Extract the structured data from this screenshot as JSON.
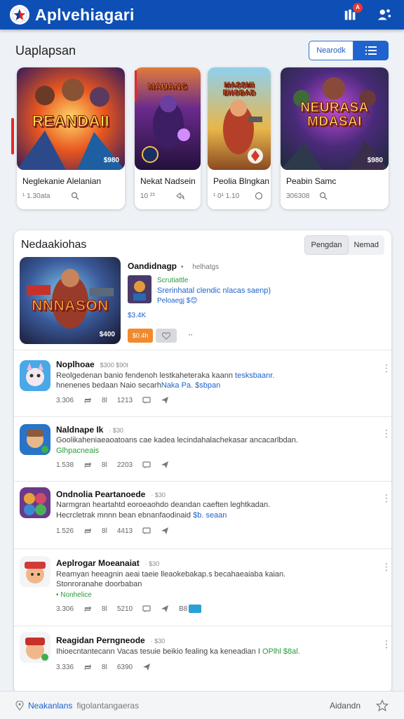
{
  "app": {
    "title": "Aplvehiagari",
    "notification_count": "A",
    "brand_color": "#0d4fb5"
  },
  "section": {
    "title": "Uaplapsan",
    "toggle_label": "Nearodk"
  },
  "cards": [
    {
      "thumb_text": "REANDAII",
      "price": "$980",
      "title": "Neglekanie Alelanian",
      "meta": "¹ 1.30ata"
    },
    {
      "thumb_text": "MAUANG",
      "title": "Nekat Nadsein",
      "meta": "10 ²³"
    },
    {
      "thumb_text": "MASSMI ENGBAD",
      "title": "Peolia Blngkan",
      "meta": "¹ 0¹ 1.10"
    },
    {
      "thumb_text": "NEURASA MDASAI",
      "price": "$980",
      "title": "Peabin Samc",
      "meta": "306308"
    }
  ],
  "panel": {
    "title": "Nedaakiohas",
    "tabs": [
      "Pengdan",
      "Nemad"
    ],
    "featured": {
      "image_text": "NNNASON",
      "image_price": "$400",
      "title": "Oandidnagp",
      "subtitle": "•  helhatgs",
      "line1": "Scrutiattle",
      "line2": "Srerinhatal clendic nlacas saenp)",
      "line3": "Peloaegj $😊",
      "price": "$3.4K",
      "buy_label": "$0.4h"
    },
    "rows": [
      {
        "title": "Noplhoae",
        "time": "$300   $90t",
        "line1a": "Reolgedenan banio fendenoh lestkaheteraka kaann ",
        "line1b": "tesksbaanr.",
        "line2a": "hnenenes bedaan Naio secarh",
        "line2b": "Naka Pa. $sbpan",
        "stats": [
          "3.306",
          "8l",
          "1213"
        ]
      },
      {
        "title": "Naldnape Ik",
        "time": "· $30",
        "line1a": "Goolikaheniaeaoatoans cae kadea lecindahalachekasar ancacarlbdan.",
        "line1b": "",
        "line2a": "",
        "line2b": "",
        "green": "Glhpacneais",
        "stats": [
          "1.538",
          "8l",
          "2203"
        ]
      },
      {
        "title": "Ondnolia Peartanoede",
        "time": "· $30",
        "line1a": "Narmgran heartahtd eoroeaohdo deandan caeften leghtkadan.",
        "line1b": "",
        "line2a": "Hecrcletrak mnnn bean ebnanfaodinaid",
        "line2b": "$b. seaan",
        "stats": [
          "1.526",
          "8l",
          "4413"
        ]
      },
      {
        "title": "Aeplrogar Moeanaiat",
        "time": "· $30",
        "line1a": "Reamyan heeagnin aeai taeie lleaokebakap.s becahaeaiaba kaian.",
        "line1b": "",
        "line2a": "Stonroranahe doorbaban",
        "line2b": "",
        "green": "• Nonhelice",
        "stats": [
          "3.306",
          "8l",
          "5210"
        ],
        "badge": "B8"
      },
      {
        "title": "Reagidan Perngneode",
        "time": "· $30",
        "line1a": "Ihioecntantecann Vacas tesuie beikio fealing ka keneadian I ",
        "line1b": "OPlhl $8al.",
        "line2a": "",
        "line2b": "",
        "stats": [
          "3.336",
          "8l",
          "6390"
        ]
      }
    ]
  },
  "bottom": {
    "location_blue": "Neakanlans",
    "location_grey": "figolantangaeras",
    "action_label": "Aidandn"
  }
}
